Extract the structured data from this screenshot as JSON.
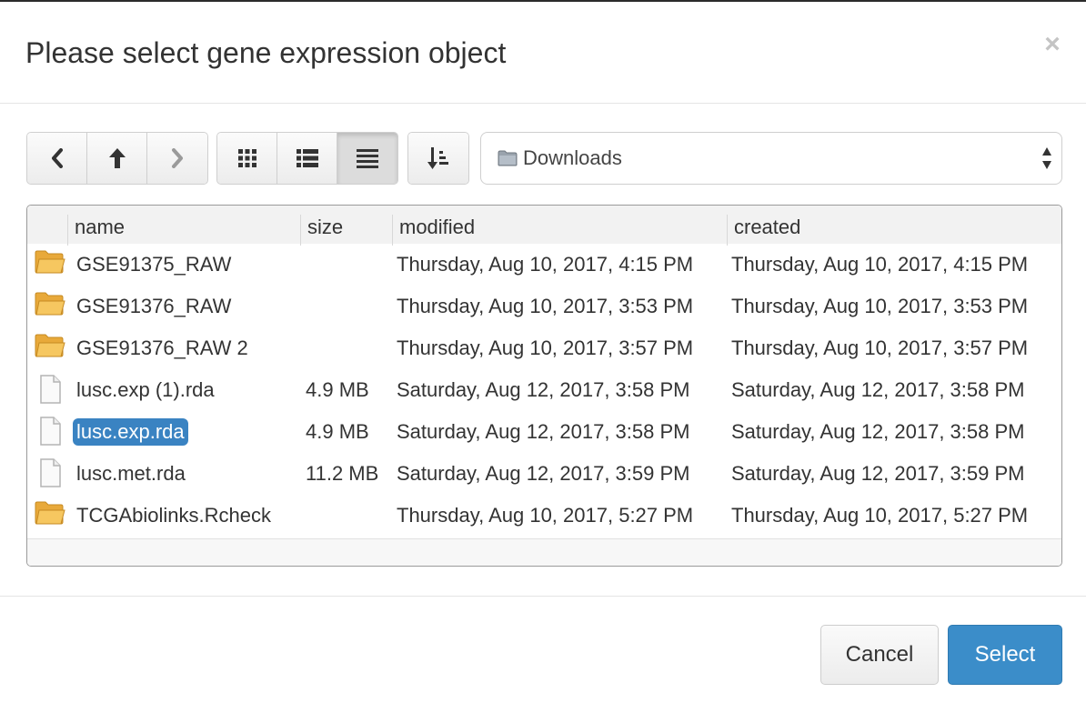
{
  "dialog": {
    "title": "Please select gene expression object",
    "close_label": "×"
  },
  "toolbar": {
    "nav_icons": [
      "chevron-left-icon",
      "arrow-up-icon",
      "chevron-right-icon"
    ],
    "view_icons": [
      "grid-view-icon",
      "list-view-icon",
      "detail-view-icon"
    ],
    "active_view": "detail-view-icon",
    "sort_icon": "sort-ascending-icon"
  },
  "location": {
    "selected": "Downloads",
    "icon": "folder-icon"
  },
  "file_list": {
    "columns": [
      "name",
      "size",
      "modified",
      "created"
    ],
    "selected_index": 4,
    "rows": [
      {
        "type": "folder",
        "name": "GSE91375_RAW",
        "size": "",
        "modified": "Thursday, Aug 10, 2017, 4:15 PM",
        "created": "Thursday, Aug 10, 2017, 4:15 PM"
      },
      {
        "type": "folder",
        "name": "GSE91376_RAW",
        "size": "",
        "modified": "Thursday, Aug 10, 2017, 3:53 PM",
        "created": "Thursday, Aug 10, 2017, 3:53 PM"
      },
      {
        "type": "folder",
        "name": "GSE91376_RAW 2",
        "size": "",
        "modified": "Thursday, Aug 10, 2017, 3:57 PM",
        "created": "Thursday, Aug 10, 2017, 3:57 PM"
      },
      {
        "type": "file",
        "name": "lusc.exp (1).rda",
        "size": "4.9 MB",
        "modified": "Saturday, Aug 12, 2017, 3:58 PM",
        "created": "Saturday, Aug 12, 2017, 3:58 PM"
      },
      {
        "type": "file",
        "name": "lusc.exp.rda",
        "size": "4.9 MB",
        "modified": "Saturday, Aug 12, 2017, 3:58 PM",
        "created": "Saturday, Aug 12, 2017, 3:58 PM"
      },
      {
        "type": "file",
        "name": "lusc.met.rda",
        "size": "11.2 MB",
        "modified": "Saturday, Aug 12, 2017, 3:59 PM",
        "created": "Saturday, Aug 12, 2017, 3:59 PM"
      },
      {
        "type": "folder",
        "name": "TCGAbiolinks.Rcheck",
        "size": "",
        "modified": "Thursday, Aug 10, 2017, 5:27 PM",
        "created": "Thursday, Aug 10, 2017, 5:27 PM"
      }
    ]
  },
  "footer": {
    "cancel_label": "Cancel",
    "select_label": "Select"
  },
  "colors": {
    "primary": "#3b8dc9",
    "selection": "#3a83c2",
    "folder": "#f0b94a"
  }
}
